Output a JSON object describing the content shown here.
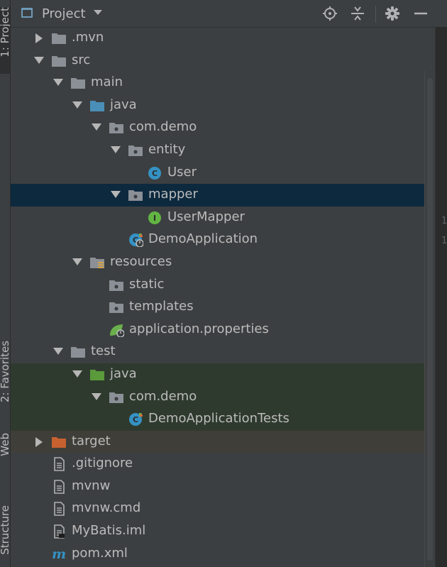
{
  "header": {
    "title": "Project"
  },
  "side_tabs": {
    "project": "1: Project",
    "favorites": "2: Favorites",
    "web": "Web",
    "structure": "Structure"
  },
  "gutter": {
    "line_a": "1",
    "line_b": "1"
  },
  "tree": [
    {
      "label": ".mvn",
      "depth": 1,
      "arrow": "right",
      "icon": "folder-icon"
    },
    {
      "label": "src",
      "depth": 1,
      "arrow": "down",
      "icon": "folder-icon"
    },
    {
      "label": "main",
      "depth": 2,
      "arrow": "down",
      "icon": "folder-icon"
    },
    {
      "label": "java",
      "depth": 3,
      "arrow": "down",
      "icon": "source-folder-icon"
    },
    {
      "label": "com.demo",
      "depth": 4,
      "arrow": "down",
      "icon": "package-icon"
    },
    {
      "label": "entity",
      "depth": 5,
      "arrow": "down",
      "icon": "package-icon"
    },
    {
      "label": "User",
      "depth": 6,
      "arrow": "none",
      "icon": "class-icon"
    },
    {
      "label": "mapper",
      "depth": 5,
      "arrow": "down",
      "icon": "package-icon",
      "selected": true
    },
    {
      "label": "UserMapper",
      "depth": 6,
      "arrow": "none",
      "icon": "interface-icon"
    },
    {
      "label": "DemoApplication",
      "depth": 5,
      "arrow": "none",
      "icon": "spring-boot-class-icon"
    },
    {
      "label": "resources",
      "depth": 3,
      "arrow": "down",
      "icon": "resources-folder-icon"
    },
    {
      "label": "static",
      "depth": 4,
      "arrow": "none",
      "icon": "package-icon"
    },
    {
      "label": "templates",
      "depth": 4,
      "arrow": "none",
      "icon": "package-icon"
    },
    {
      "label": "application.properties",
      "depth": 4,
      "arrow": "none",
      "icon": "spring-properties-icon"
    },
    {
      "label": "test",
      "depth": 2,
      "arrow": "down",
      "icon": "folder-icon"
    },
    {
      "label": "java",
      "depth": 3,
      "arrow": "down",
      "icon": "test-folder-icon",
      "bg": "test"
    },
    {
      "label": "com.demo",
      "depth": 4,
      "arrow": "down",
      "icon": "package-icon",
      "bg": "test"
    },
    {
      "label": "DemoApplicationTests",
      "depth": 5,
      "arrow": "none",
      "icon": "spring-boot-test-icon",
      "bg": "test"
    },
    {
      "label": "target",
      "depth": 1,
      "arrow": "right",
      "icon": "excluded-folder-icon",
      "bg": "excluded"
    },
    {
      "label": ".gitignore",
      "depth": 1,
      "arrow": "none",
      "icon": "text-file-icon"
    },
    {
      "label": "mvnw",
      "depth": 1,
      "arrow": "none",
      "icon": "text-file-icon"
    },
    {
      "label": "mvnw.cmd",
      "depth": 1,
      "arrow": "none",
      "icon": "text-file-icon"
    },
    {
      "label": "MyBatis.iml",
      "depth": 1,
      "arrow": "none",
      "icon": "iml-file-icon"
    },
    {
      "label": "pom.xml",
      "depth": 1,
      "arrow": "none",
      "icon": "maven-icon"
    }
  ],
  "colors": {
    "background": "#3c3f41",
    "selection": "#0d293e",
    "test_background": "#2f3a2e",
    "excluded_background": "#3f3e38",
    "folder": "#8a9096",
    "source_folder": "#4a8fb8",
    "test_folder": "#5a9a3a",
    "excluded_folder": "#c7612f",
    "class_icon": "#3592c4",
    "interface_icon": "#62b543",
    "maven": "#3592c4"
  }
}
